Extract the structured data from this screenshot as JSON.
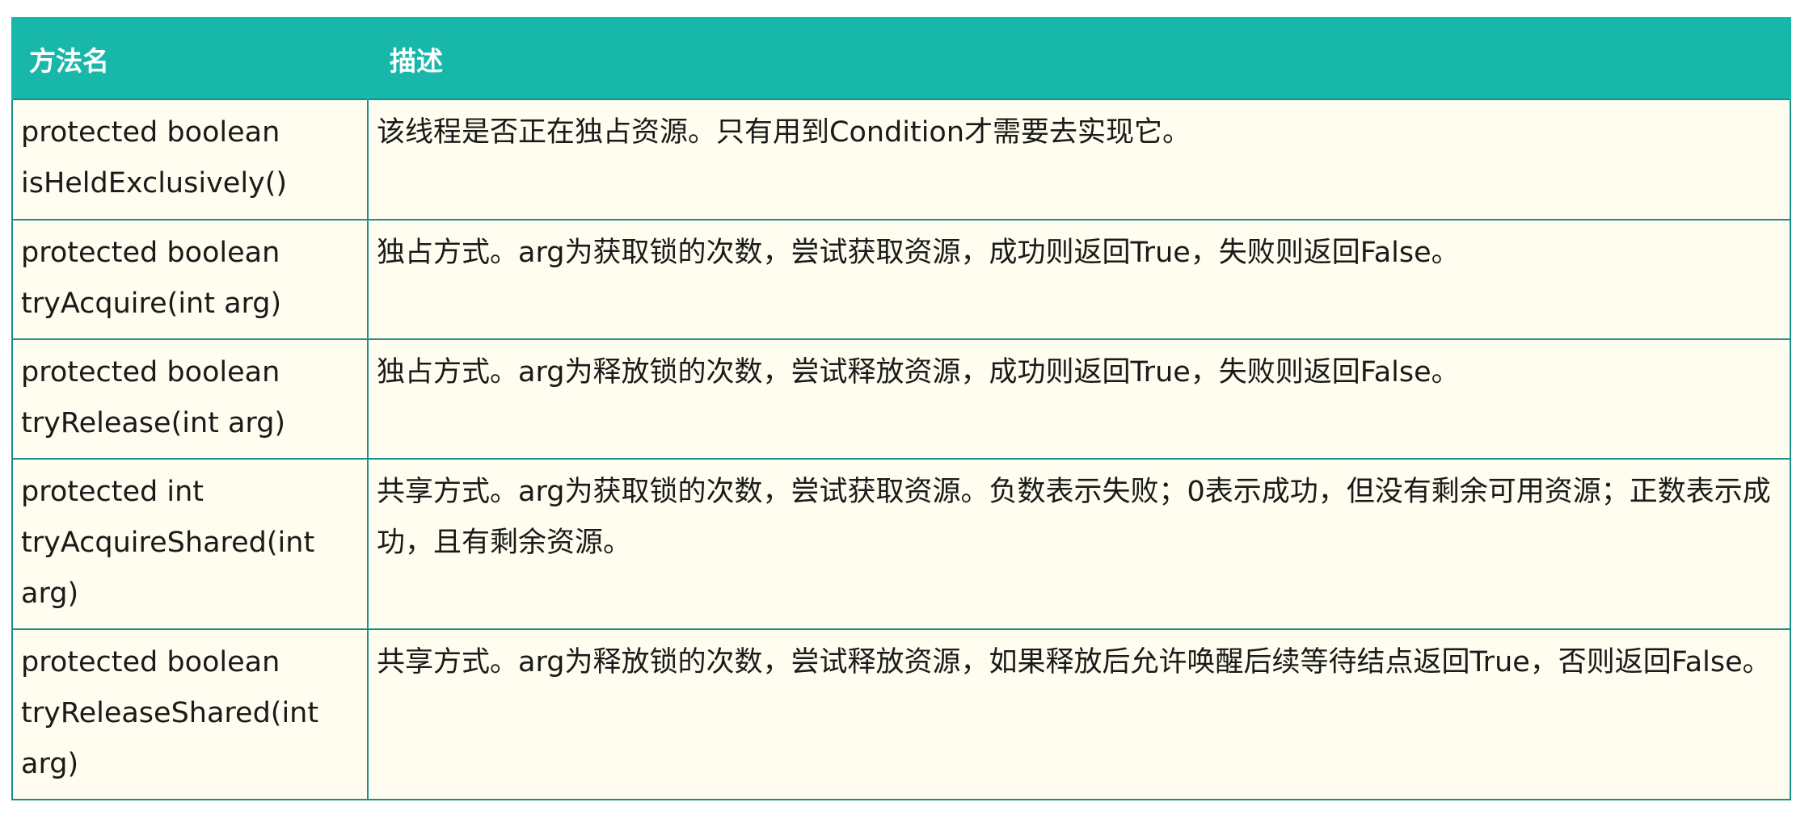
{
  "colors": {
    "header_bg": "#17b8aa",
    "header_fg": "#ffffff",
    "cell_bg": "#fefdef",
    "border": "#1a8f87"
  },
  "table": {
    "headers": [
      "方法名",
      "描述"
    ],
    "rows": [
      {
        "method_lines": [
          "protected boolean",
          "isHeldExclusively()"
        ],
        "desc_lines": [
          "该线程是否正在独占资源。只有用到Condition才需要去实现它。"
        ]
      },
      {
        "method_lines": [
          "protected boolean",
          "tryAcquire(int arg)"
        ],
        "desc_lines": [
          "独占方式。arg为获取锁的次数，尝试获取资源，成功则返回True，失败则返回False。"
        ]
      },
      {
        "method_lines": [
          "protected boolean",
          "tryRelease(int arg)"
        ],
        "desc_lines": [
          "独占方式。arg为释放锁的次数，尝试释放资源，成功则返回True，失败则返回False。"
        ]
      },
      {
        "method_lines": [
          "protected int",
          "tryAcquireShared(int",
          "arg)"
        ],
        "desc_lines": [
          "共享方式。arg为获取锁的次数，尝试获取资源。负数表示失败；0表示成功，但没有剩余可用资源；正数表示成",
          "功，且有剩余资源。"
        ]
      },
      {
        "method_lines": [
          "protected boolean",
          "tryReleaseShared(int",
          "arg)"
        ],
        "desc_lines": [
          "共享方式。arg为释放锁的次数，尝试释放资源，如果释放后允许唤醒后续等待结点返回True，否则返回False。"
        ]
      }
    ]
  }
}
